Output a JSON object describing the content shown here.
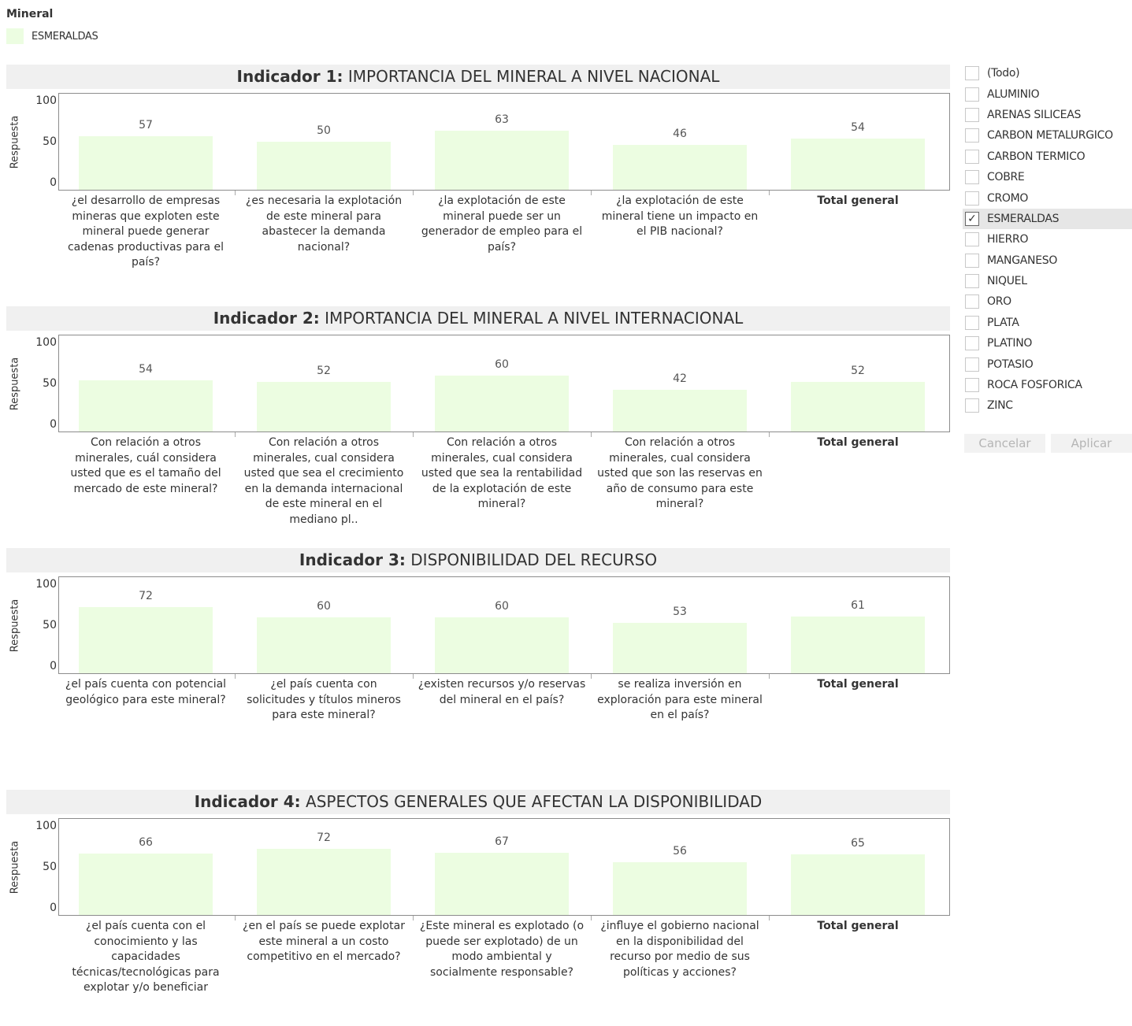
{
  "legend": {
    "title": "Mineral",
    "items": [
      {
        "label": "ESMERALDAS",
        "color": "#ecfde1"
      }
    ]
  },
  "filter": {
    "options": [
      "(Todo)",
      "ALUMINIO",
      "ARENAS SILICEAS",
      "CARBON METALURGICO",
      "CARBON TERMICO",
      "COBRE",
      "CROMO",
      "ESMERALDAS",
      "HIERRO",
      "MANGANESO",
      "NIQUEL",
      "ORO",
      "PLATA",
      "PLATINO",
      "POTASIO",
      "ROCA FOSFORICA",
      "ZINC"
    ],
    "selected": "ESMERALDAS",
    "check_glyph": "✓",
    "cancel_label": "Cancelar",
    "apply_label": "Aplicar"
  },
  "chart_data": [
    {
      "type": "bar",
      "title_bold": "Indicador 1:",
      "title": "IMPORTANCIA DEL MINERAL A NIVEL NACIONAL",
      "ylabel": "Respuesta",
      "ylim": [
        0,
        100
      ],
      "yticks": [
        "100",
        "50",
        "0"
      ],
      "categories": [
        "¿el desarrollo de empresas mineras que exploten este mineral puede generar cadenas productivas para el país?",
        "¿es necesaria la explotación de este mineral para abastecer la demanda nacional?",
        "¿la explotación de este mineral puede ser un generador de empleo para el país?",
        "¿la explotación de este mineral tiene un impacto en el PIB nacional?",
        "Total general"
      ],
      "values": [
        57,
        50,
        63,
        46,
        54
      ]
    },
    {
      "type": "bar",
      "title_bold": "Indicador 2:",
      "title": "IMPORTANCIA DEL MINERAL A NIVEL INTERNACIONAL",
      "ylabel": "Respuesta",
      "ylim": [
        0,
        100
      ],
      "yticks": [
        "100",
        "50",
        "0"
      ],
      "categories": [
        "Con relación a otros minerales, cuál considera usted que es el tamaño del mercado de este mineral?",
        "Con relación a otros minerales, cual considera usted que sea el crecimiento en la demanda internacional de este mineral en el mediano pl..",
        "Con relación a otros minerales, cual considera usted que sea la rentabilidad de la explotación de este mineral?",
        "Con relación a otros minerales, cual considera usted que son las reservas en año de consumo para este mineral?",
        "Total general"
      ],
      "values": [
        54,
        52,
        60,
        42,
        52
      ]
    },
    {
      "type": "bar",
      "title_bold": "Indicador 3:",
      "title": "DISPONIBILIDAD DEL RECURSO",
      "ylabel": "Respuesta",
      "ylim": [
        0,
        100
      ],
      "yticks": [
        "100",
        "50",
        "0"
      ],
      "categories": [
        "¿el país cuenta con potencial geológico para este mineral?",
        "¿el país cuenta con solicitudes y títulos mineros para este mineral?",
        "¿existen recursos y/o reservas del mineral en el país?",
        "se realiza inversión en exploración para este mineral en el país?",
        "Total general"
      ],
      "values": [
        72,
        60,
        60,
        53,
        61
      ]
    },
    {
      "type": "bar",
      "title_bold": "Indicador 4:",
      "title": "ASPECTOS GENERALES QUE AFECTAN LA DISPONIBILIDAD",
      "ylabel": "Respuesta",
      "ylim": [
        0,
        100
      ],
      "yticks": [
        "100",
        "50",
        "0"
      ],
      "categories": [
        "¿el país cuenta con el conocimiento y las capacidades técnicas/tecnológicas para explotar y/o beneficiar",
        "¿en el país se puede explotar este mineral a un costo competitivo en el mercado?",
        "¿Este mineral es explotado (o puede ser explotado) de un modo ambiental y socialmente responsable?",
        "¿influye el gobierno nacional en la disponibilidad del recurso por medio de sus políticas y acciones?",
        "Total general"
      ],
      "values": [
        66,
        72,
        67,
        56,
        65
      ]
    }
  ]
}
